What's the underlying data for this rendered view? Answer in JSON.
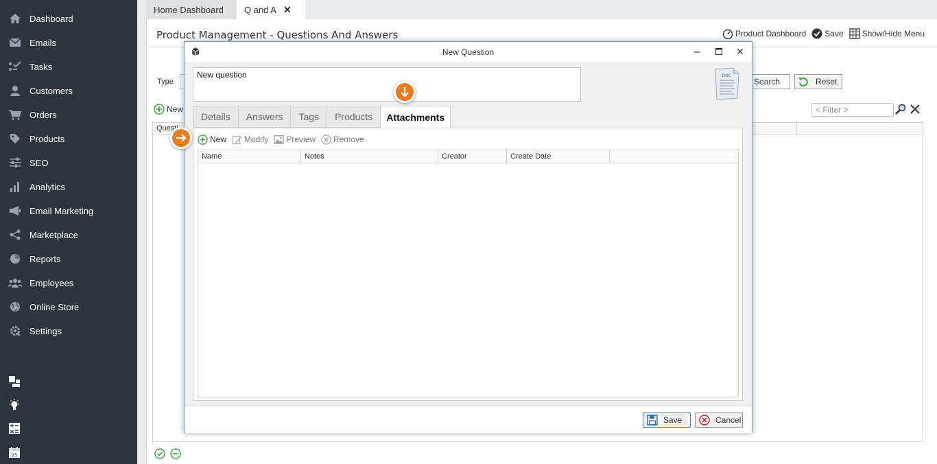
{
  "sidebar": {
    "items": [
      {
        "label": "Dashboard",
        "icon": "home-icon"
      },
      {
        "label": "Emails",
        "icon": "envelope-icon"
      },
      {
        "label": "Tasks",
        "icon": "tasks-icon"
      },
      {
        "label": "Customers",
        "icon": "user-icon"
      },
      {
        "label": "Orders",
        "icon": "cart-icon"
      },
      {
        "label": "Products",
        "icon": "tag-icon"
      },
      {
        "label": "SEO",
        "icon": "sliders-icon"
      },
      {
        "label": "Analytics",
        "icon": "bar-chart-icon"
      },
      {
        "label": "Email Marketing",
        "icon": "megaphone-icon"
      },
      {
        "label": "Marketplace",
        "icon": "share-icon"
      },
      {
        "label": "Reports",
        "icon": "pie-chart-icon"
      },
      {
        "label": "Employees",
        "icon": "users-icon"
      },
      {
        "label": "Online Store",
        "icon": "globe-icon"
      },
      {
        "label": "Settings",
        "icon": "gear-icon"
      }
    ],
    "bottom_icons": [
      "layout-icon",
      "lightbulb-icon",
      "calculator-icon",
      "calendar-icon"
    ]
  },
  "top_tabs": {
    "home": "Home Dashboard",
    "qa": "Q and A"
  },
  "page": {
    "title": "Product Management - Questions And Answers",
    "product_dashboard": "Product Dashboard",
    "save": "Save",
    "show_hide_menu": "Show/Hide Menu",
    "type_label": "Type",
    "search_label": "Search",
    "reset_label": "Reset",
    "new_label": "New",
    "filter_placeholder": "< Filter >",
    "grid_header": "Questi"
  },
  "modal": {
    "title": "New Question",
    "question_text": "New question",
    "tabs": [
      "Details",
      "Answers",
      "Tags",
      "Products",
      "Attachments"
    ],
    "active_tab": "Attachments",
    "toolbar": {
      "new": "New",
      "modify": "Modify",
      "preview": "Preview",
      "remove": "Remove"
    },
    "columns": [
      "Name",
      "Notes",
      "Creator",
      "Create Date"
    ],
    "save": "Save",
    "cancel": "Cancel"
  },
  "colors": {
    "sidebar_bg": "#2f353d",
    "hint_orange": "#ea7b1e",
    "green": "#3aa537",
    "red": "#d8262f"
  }
}
